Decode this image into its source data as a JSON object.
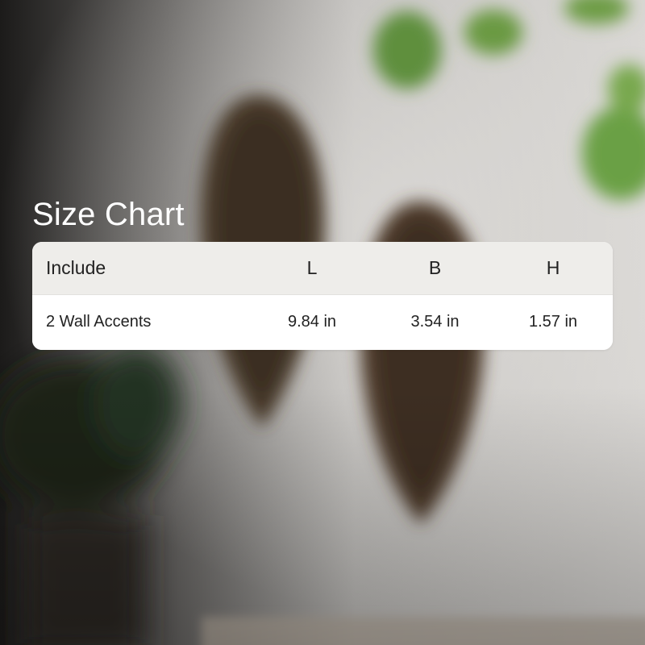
{
  "title": "Size Chart",
  "table": {
    "headers": [
      "Include",
      "L",
      "B",
      "H"
    ],
    "rows": [
      [
        "2 Wall Accents",
        "9.84 in",
        "3.54 in",
        "1.57 in"
      ]
    ]
  },
  "colors": {
    "header_row": "#eeedea",
    "body_row": "#ffffff",
    "title_text": "#ffffff",
    "cell_text": "#222222"
  }
}
